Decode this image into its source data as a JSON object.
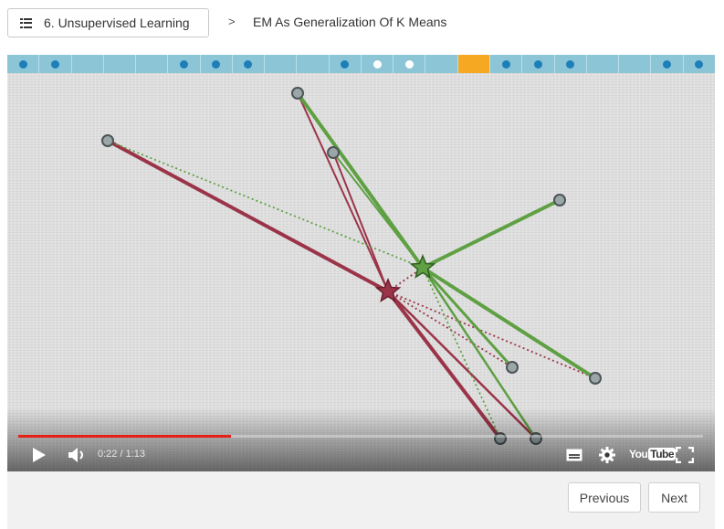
{
  "breadcrumb": {
    "lesson_label": "6. Unsupervised Learning",
    "separator": ">",
    "current_title": "EM As Generalization Of K Means"
  },
  "progress": {
    "segments": [
      "done",
      "done",
      "none",
      "none",
      "none",
      "done",
      "done",
      "done",
      "none",
      "none",
      "done",
      "viewed",
      "viewed",
      "none",
      "current",
      "done",
      "done",
      "done",
      "none",
      "none",
      "done",
      "done"
    ],
    "colors": {
      "strip": "#8cc5d6",
      "done": "#1d7fb8",
      "current": "#f7a823"
    }
  },
  "video": {
    "time_display": "0:22 / 1:13",
    "progress_fraction": 0.31,
    "logo_you": "You",
    "logo_tube": "Tube",
    "icons": [
      "play-icon",
      "volume-icon",
      "captions-icon",
      "settings-icon",
      "fullscreen-icon"
    ],
    "colors": {
      "red_cluster": "#9b3448",
      "green_cluster": "#5fa043",
      "scrub": "#e62117"
    }
  },
  "navigation": {
    "previous_label": "Previous",
    "next_label": "Next"
  }
}
